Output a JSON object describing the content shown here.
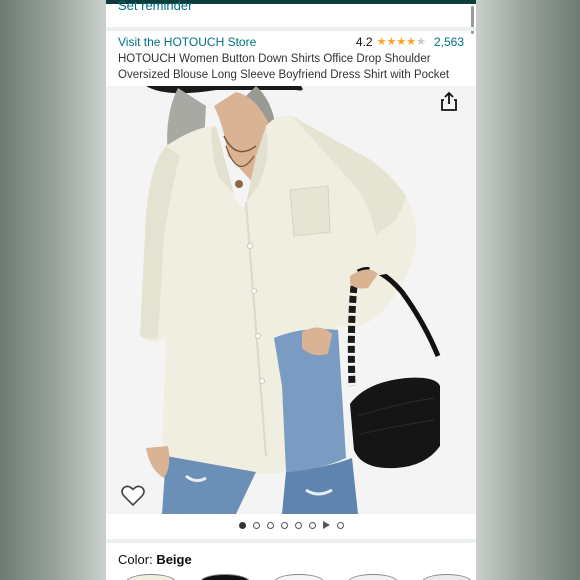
{
  "header": {
    "reminder_label": "Set reminder"
  },
  "store": {
    "link_label": "Visit the HOTOUCH Store"
  },
  "rating": {
    "value": "4.2",
    "stars_filled": 4,
    "stars_total": 5,
    "count": "2,563"
  },
  "product": {
    "title": "HOTOUCH Women Button Down Shirts Office Drop Shoulder Oversized Blouse Long Sleeve Boyfriend Dress Shirt with Pocket"
  },
  "gallery": {
    "active_index": 0,
    "image_dots": 6,
    "has_video": true,
    "extra_dots_after_video": 1
  },
  "selection": {
    "color_label": "Color:",
    "color_value": "Beige"
  },
  "icons": {
    "share": "share-icon",
    "wishlist": "heart-icon",
    "star": "star-icon"
  },
  "colors": {
    "link": "#007185",
    "star": "#ffa41c",
    "shirt": "#efeee0"
  }
}
